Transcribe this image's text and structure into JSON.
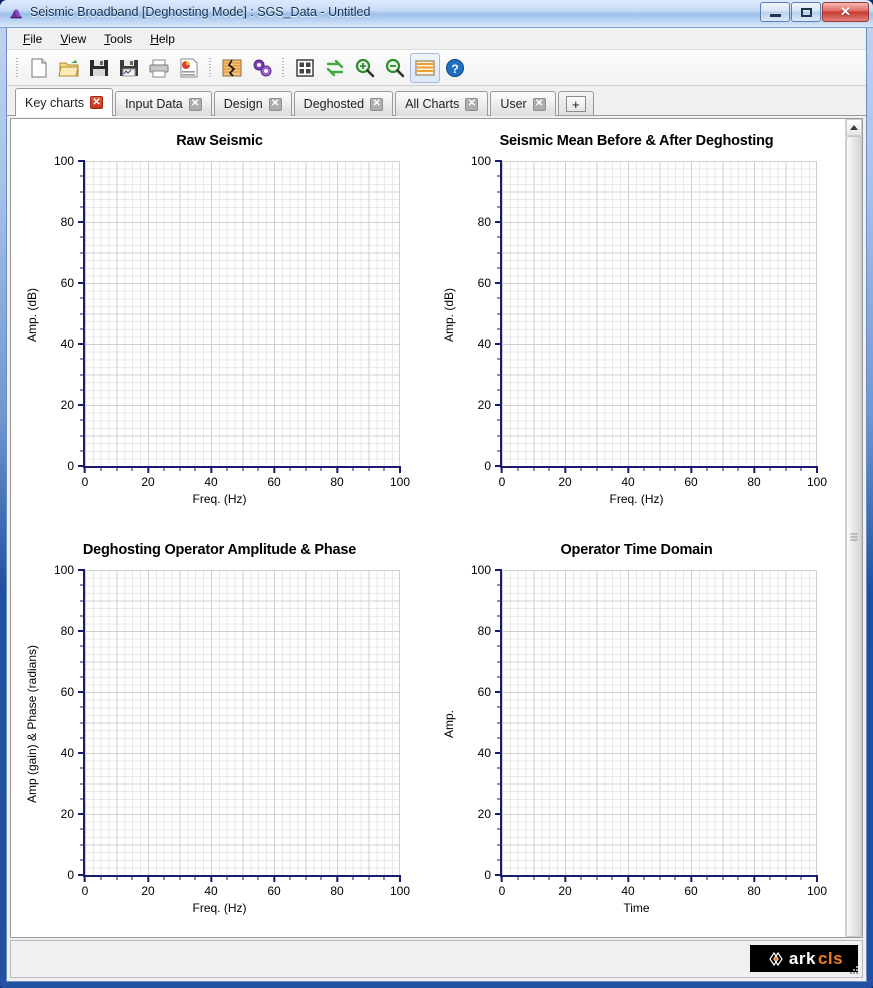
{
  "window": {
    "title": "Seismic Broadband [Deghosting Mode] : SGS_Data - Untitled",
    "icon": "app-icon",
    "buttons": {
      "minimize": "minimize-button",
      "maximize": "maximize-button",
      "close_label": "✕"
    }
  },
  "menu": {
    "items": [
      {
        "accel": "F",
        "rest": "ile"
      },
      {
        "accel": "V",
        "rest": "iew"
      },
      {
        "accel": "T",
        "rest": "ools"
      },
      {
        "accel": "H",
        "rest": "elp"
      }
    ]
  },
  "toolbar": {
    "groups": [
      [
        "new-document-icon",
        "open-folder-icon",
        "save-icon",
        "save-as-icon",
        "print-icon",
        "report-icon"
      ],
      [
        "seismic-trace-icon",
        "gears-process-icon"
      ],
      [
        "grid-layout-icon",
        "refresh-icon",
        "zoom-in-icon",
        "zoom-out-icon",
        "chart-display-icon",
        "help-icon"
      ]
    ]
  },
  "tabs": {
    "items": [
      {
        "label": "Key charts",
        "active": true,
        "closable": true
      },
      {
        "label": "Input Data",
        "active": false,
        "closable": true
      },
      {
        "label": "Design",
        "active": false,
        "closable": true
      },
      {
        "label": "Deghosted",
        "active": false,
        "closable": true
      },
      {
        "label": "All Charts",
        "active": false,
        "closable": true
      },
      {
        "label": "User",
        "active": false,
        "closable": true
      }
    ],
    "close_glyph": "✕",
    "add_label": "+"
  },
  "chart_data": [
    {
      "type": "line",
      "title": "Raw Seismic",
      "xlabel": "Freq. (Hz)",
      "ylabel": "Amp. (dB)",
      "xlim": [
        0,
        100
      ],
      "ylim": [
        0,
        100
      ],
      "xticks": [
        0,
        20,
        40,
        60,
        80,
        100
      ],
      "yticks": [
        0,
        20,
        40,
        60,
        80,
        100
      ],
      "x_minor_step": 5,
      "y_minor_step": 5,
      "grid": true,
      "series": [],
      "values": [],
      "legend": null,
      "note": "empty plot - no data plotted"
    },
    {
      "type": "line",
      "title": "Seismic Mean Before & After Deghosting",
      "xlabel": "Freq. (Hz)",
      "ylabel": "Amp. (dB)",
      "xlim": [
        0,
        100
      ],
      "ylim": [
        0,
        100
      ],
      "xticks": [
        0,
        20,
        40,
        60,
        80,
        100
      ],
      "yticks": [
        0,
        20,
        40,
        60,
        80,
        100
      ],
      "x_minor_step": 5,
      "y_minor_step": 5,
      "grid": true,
      "series": [],
      "values": [],
      "legend": null,
      "note": "empty plot - no data plotted"
    },
    {
      "type": "line",
      "title": "Deghosting Operator Amplitude & Phase",
      "xlabel": "Freq. (Hz)",
      "ylabel": "Amp (gain) & Phase (radians)",
      "xlim": [
        0,
        100
      ],
      "ylim": [
        0,
        100
      ],
      "xticks": [
        0,
        20,
        40,
        60,
        80,
        100
      ],
      "yticks": [
        0,
        20,
        40,
        60,
        80,
        100
      ],
      "x_minor_step": 5,
      "y_minor_step": 5,
      "grid": true,
      "series": [],
      "values": [],
      "legend": null,
      "note": "empty plot - no data plotted"
    },
    {
      "type": "line",
      "title": "Operator Time Domain",
      "xlabel": "Time",
      "ylabel": "Amp.",
      "xlim": [
        0,
        100
      ],
      "ylim": [
        0,
        100
      ],
      "xticks": [
        0,
        20,
        40,
        60,
        80,
        100
      ],
      "yticks": [
        0,
        20,
        40,
        60,
        80,
        100
      ],
      "x_minor_step": 5,
      "y_minor_step": 5,
      "grid": true,
      "series": [],
      "values": [],
      "legend": null,
      "note": "empty plot - no data plotted"
    }
  ],
  "scrollbar": {
    "up_arrow": "scroll-up-arrow",
    "orientation": "vertical"
  },
  "statusbar": {
    "text": "",
    "logo": {
      "part1": "ark",
      "part2": "cls"
    }
  },
  "colors": {
    "axis": "#1a1a6e",
    "grid_major": "#cfcfcf",
    "grid_minor": "#e8e8e8",
    "accent_close": "#c9331c",
    "logo_orange": "#f07d20",
    "titlebar": "#c9dcf6"
  }
}
